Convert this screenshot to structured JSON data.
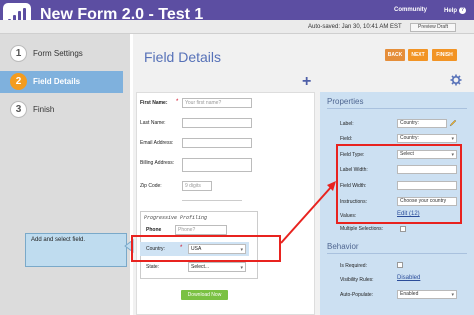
{
  "header": {
    "app_title": "New Form 2.0 - Test 1",
    "community": "Community",
    "help": "Help",
    "help_glyph": "?",
    "autosaved": "Auto-saved: Jan 30, 10:41 AM EST",
    "preview_draft": "Preview Draft"
  },
  "steps": [
    {
      "num": "1",
      "label": "Form Settings",
      "active": false
    },
    {
      "num": "2",
      "label": "Field Details",
      "active": true
    },
    {
      "num": "3",
      "label": "Finish",
      "active": false
    }
  ],
  "main": {
    "page_title": "Field Details",
    "back": "BACK",
    "next": "NEXT",
    "finish": "FINISH",
    "plus": "+"
  },
  "form": {
    "fields": [
      {
        "label": "First Name:",
        "required": true,
        "placeholder": "Your first name?"
      },
      {
        "label": "Last Name:",
        "required": false,
        "placeholder": ""
      },
      {
        "label": "Email Address:",
        "required": false,
        "placeholder": ""
      },
      {
        "label": "Billing Address:",
        "required": false,
        "placeholder": ""
      },
      {
        "label": "Zip Code:",
        "required": false,
        "placeholder": "9 digits"
      }
    ],
    "req_mark": "*",
    "progressive_profiling": "Progressive Profiling",
    "phone_label": "Phone",
    "phone_placeholder": "Phone?",
    "country_label": "Country:",
    "country_value": "USA",
    "state_label": "State:",
    "state_value": "Select...",
    "download_button": "Download Now"
  },
  "properties": {
    "title": "Properties",
    "rows": [
      {
        "label": "Label:",
        "value": "Country:"
      },
      {
        "label": "Field:",
        "value": "Country:"
      },
      {
        "label": "Field Type:",
        "value": "Select"
      },
      {
        "label": "Label Width:",
        "value": ""
      },
      {
        "label": "Field Width:",
        "value": ""
      },
      {
        "label": "Instructions:",
        "value": "Choose your country"
      }
    ],
    "values_label": "Values:",
    "values_link": "Edit (12)",
    "multiple_label": "Multiple Selections:"
  },
  "behavior": {
    "title": "Behavior",
    "is_required": "Is Required:",
    "visibility_rules": "Visibility Rules:",
    "visibility_value": "Disabled",
    "auto_populate": "Auto-Populate:",
    "auto_populate_value": "Enabled"
  },
  "callout": {
    "text": "Add and select field."
  },
  "colors": {
    "header": "#5c4ea2",
    "accent_orange": "#f29425",
    "panel_blue": "#cce0f2",
    "highlight_red": "#e8231f",
    "title_blue": "#5671b8"
  }
}
